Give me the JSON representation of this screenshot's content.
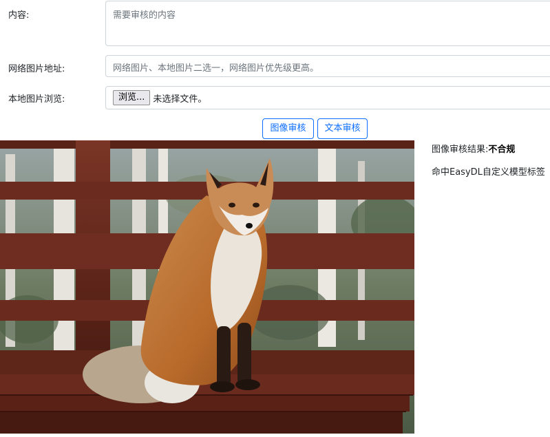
{
  "form": {
    "content_label": "内容:",
    "content_placeholder": "需要审核的内容",
    "url_label": "网络图片地址:",
    "url_placeholder": "网络图片、本地图片二选一，网络图片优先级更高。",
    "local_label": "本地图片浏览:",
    "browse_button": "浏览...",
    "file_status": "未选择文件。"
  },
  "actions": {
    "image_review": "图像审核",
    "text_review": "文本审核"
  },
  "result": {
    "label": "图像审核结果:",
    "value": "不合规",
    "detail": "命中EasyDL自定义模型标签"
  },
  "colors": {
    "primary": "#0d6efd",
    "border": "#ced4da",
    "placeholder": "#6c757d"
  }
}
